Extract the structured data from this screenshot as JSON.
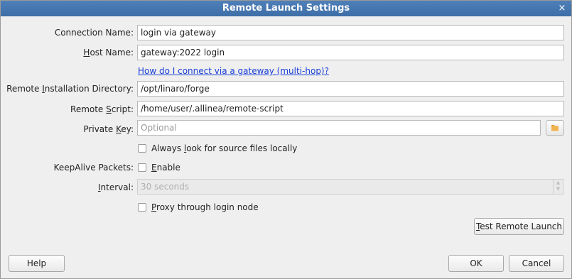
{
  "window": {
    "title": "Remote Launch Settings",
    "close_glyph": "×"
  },
  "fields": {
    "connection_name": {
      "label": "Connection Name:",
      "value": "login via gateway"
    },
    "host_name": {
      "label_pre": "",
      "label_mn": "H",
      "label_post": "ost Name:",
      "value": "gateway:2022 login"
    },
    "gateway_link": "How do I connect via a gateway (multi-hop)?",
    "install_dir": {
      "label_pre": "Remote ",
      "label_mn": "I",
      "label_post": "nstallation Directory:",
      "value": "/opt/linaro/forge"
    },
    "remote_script": {
      "label_pre": "Remote ",
      "label_mn": "S",
      "label_post": "cript:",
      "value": "/home/user/.allinea/remote-script"
    },
    "private_key": {
      "label_pre": "Private ",
      "label_mn": "K",
      "label_post": "ey:",
      "placeholder": "Optional"
    },
    "always_look": {
      "pre": "Always ",
      "mn": "l",
      "post": "ook for source files locally",
      "checked": false
    },
    "keepalive": {
      "label": "KeepAlive Packets:",
      "enable_mn": "E",
      "enable_post": "nable",
      "checked": false
    },
    "interval": {
      "label_pre": "",
      "label_mn": "I",
      "label_post": "nterval:",
      "value": "30 seconds"
    },
    "proxy": {
      "pre": "",
      "mn": "P",
      "post": "roxy through login node",
      "checked": false
    }
  },
  "buttons": {
    "test_mn": "T",
    "test_post": "est Remote Launch",
    "help": "Help",
    "ok": "OK",
    "cancel": "Cancel"
  },
  "icons": {
    "folder": "folder-icon",
    "spin_up": "▲",
    "spin_down": "▼"
  },
  "colors": {
    "title_bar": "#3e6ea8",
    "link": "#1a3fd6",
    "folder": "#e8a23a"
  }
}
